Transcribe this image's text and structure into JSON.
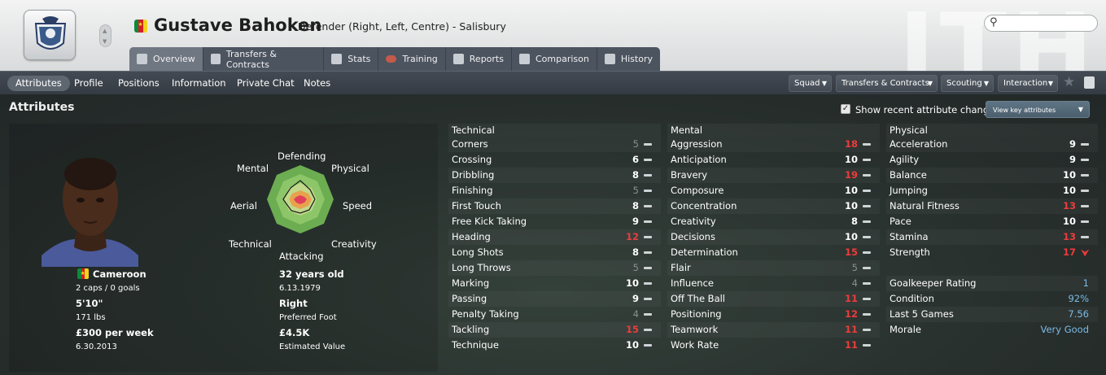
{
  "player": {
    "name": "Gustave Bahoken",
    "role": "Defender (Right, Left, Centre) - Salisbury"
  },
  "search": {
    "placeholder": ""
  },
  "tabs": [
    {
      "label": "Overview",
      "icon": "person-card-icon"
    },
    {
      "label": "Transfers & Contracts",
      "icon": "document-icon"
    },
    {
      "label": "Stats",
      "icon": "bar-chart-icon"
    },
    {
      "label": "Training",
      "icon": "ball-icon"
    },
    {
      "label": "Reports",
      "icon": "report-icon"
    },
    {
      "label": "Comparison",
      "icon": "compare-icon"
    },
    {
      "label": "History",
      "icon": "book-icon"
    }
  ],
  "subnav": [
    "Attributes",
    "Profile",
    "Positions",
    "Information",
    "Private Chat",
    "Notes"
  ],
  "dropdowns": [
    "Squad",
    "Transfers & Contracts",
    "Scouting",
    "Interaction"
  ],
  "section_title": "Attributes",
  "show_recent": "Show recent attribute changes",
  "view_key": "View key attributes",
  "radar_labels": {
    "top": "Defending",
    "tr": "Physical",
    "r": "Speed",
    "br": "Creativity",
    "bottom": "Attacking",
    "bl": "Technical",
    "l": "Aerial",
    "tl": "Mental"
  },
  "bio": {
    "nation": "Cameroon",
    "caps": "2 caps / 0 goals",
    "height": "5'10\"",
    "weight": "171 lbs",
    "wage": "£300 per week",
    "contract": "6.30.2013",
    "age": "32 years old",
    "dob": "6.13.1979",
    "foot": "Right",
    "foot_label": "Preferred Foot",
    "value": "£4.5K",
    "value_label": "Estimated Value"
  },
  "technical": {
    "header": "Technical",
    "rows": [
      [
        "Corners",
        "5",
        "g"
      ],
      [
        "Crossing",
        "6",
        "w"
      ],
      [
        "Dribbling",
        "8",
        "w"
      ],
      [
        "Finishing",
        "5",
        "g"
      ],
      [
        "First Touch",
        "8",
        "w"
      ],
      [
        "Free Kick Taking",
        "9",
        "w"
      ],
      [
        "Heading",
        "12",
        "r"
      ],
      [
        "Long Shots",
        "8",
        "w"
      ],
      [
        "Long Throws",
        "5",
        "g"
      ],
      [
        "Marking",
        "10",
        "w"
      ],
      [
        "Passing",
        "9",
        "w"
      ],
      [
        "Penalty Taking",
        "4",
        "g"
      ],
      [
        "Tackling",
        "15",
        "r"
      ],
      [
        "Technique",
        "10",
        "w"
      ]
    ]
  },
  "mental": {
    "header": "Mental",
    "rows": [
      [
        "Aggression",
        "18",
        "r"
      ],
      [
        "Anticipation",
        "10",
        "w"
      ],
      [
        "Bravery",
        "19",
        "r"
      ],
      [
        "Composure",
        "10",
        "w"
      ],
      [
        "Concentration",
        "10",
        "w"
      ],
      [
        "Creativity",
        "8",
        "w"
      ],
      [
        "Decisions",
        "10",
        "w"
      ],
      [
        "Determination",
        "15",
        "r"
      ],
      [
        "Flair",
        "5",
        "g"
      ],
      [
        "Influence",
        "4",
        "g"
      ],
      [
        "Off The Ball",
        "11",
        "r"
      ],
      [
        "Positioning",
        "12",
        "r"
      ],
      [
        "Teamwork",
        "11",
        "r"
      ],
      [
        "Work Rate",
        "11",
        "r"
      ]
    ]
  },
  "physical": {
    "header": "Physical",
    "rows": [
      [
        "Acceleration",
        "9",
        "w"
      ],
      [
        "Agility",
        "9",
        "w"
      ],
      [
        "Balance",
        "10",
        "w"
      ],
      [
        "Jumping",
        "10",
        "w"
      ],
      [
        "Natural Fitness",
        "13",
        "r"
      ],
      [
        "Pace",
        "10",
        "w"
      ],
      [
        "Stamina",
        "13",
        "r"
      ],
      [
        "Strength",
        "17",
        "r"
      ]
    ]
  },
  "extra": [
    [
      "Goalkeeper Rating",
      "1"
    ],
    [
      "Condition",
      "92%"
    ],
    [
      "Last 5 Games",
      "7.56"
    ],
    [
      "Morale",
      "Very Good"
    ]
  ]
}
